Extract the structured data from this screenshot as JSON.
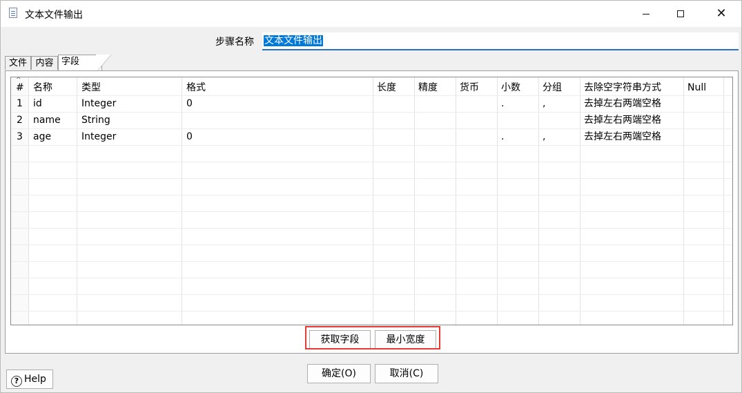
{
  "window": {
    "title": "文本文件输出"
  },
  "step": {
    "label": "步骤名称",
    "value": "文本文件输出"
  },
  "tabs": [
    {
      "label": "文件"
    },
    {
      "label": "内容"
    },
    {
      "label": "字段"
    }
  ],
  "table": {
    "headers": [
      "#",
      "名称",
      "类型",
      "格式",
      "长度",
      "精度",
      "货币",
      "小数",
      "分组",
      "去除空字符串方式",
      "Null"
    ],
    "rows": [
      {
        "num": "1",
        "name": "id",
        "type": "Integer",
        "format": "0",
        "length": "",
        "precision": "",
        "currency": "",
        "decimal": ".",
        "group": ",",
        "trim": "去掉左右两端空格",
        "null": ""
      },
      {
        "num": "2",
        "name": "name",
        "type": "String",
        "format": "",
        "length": "",
        "precision": "",
        "currency": "",
        "decimal": "",
        "group": "",
        "trim": "去掉左右两端空格",
        "null": ""
      },
      {
        "num": "3",
        "name": "age",
        "type": "Integer",
        "format": "0",
        "length": "",
        "precision": "",
        "currency": "",
        "decimal": ".",
        "group": ",",
        "trim": "去掉左右两端空格",
        "null": ""
      }
    ]
  },
  "buttons": {
    "get_fields": "获取字段",
    "min_width": "最小宽度",
    "ok": "确定(O)",
    "cancel": "取消(C)",
    "help": "Help"
  },
  "icons": {
    "app": "text-file-output-icon",
    "help": "help-icon"
  },
  "colors": {
    "highlight_border": "#e53935",
    "selection": "#0078d7"
  }
}
